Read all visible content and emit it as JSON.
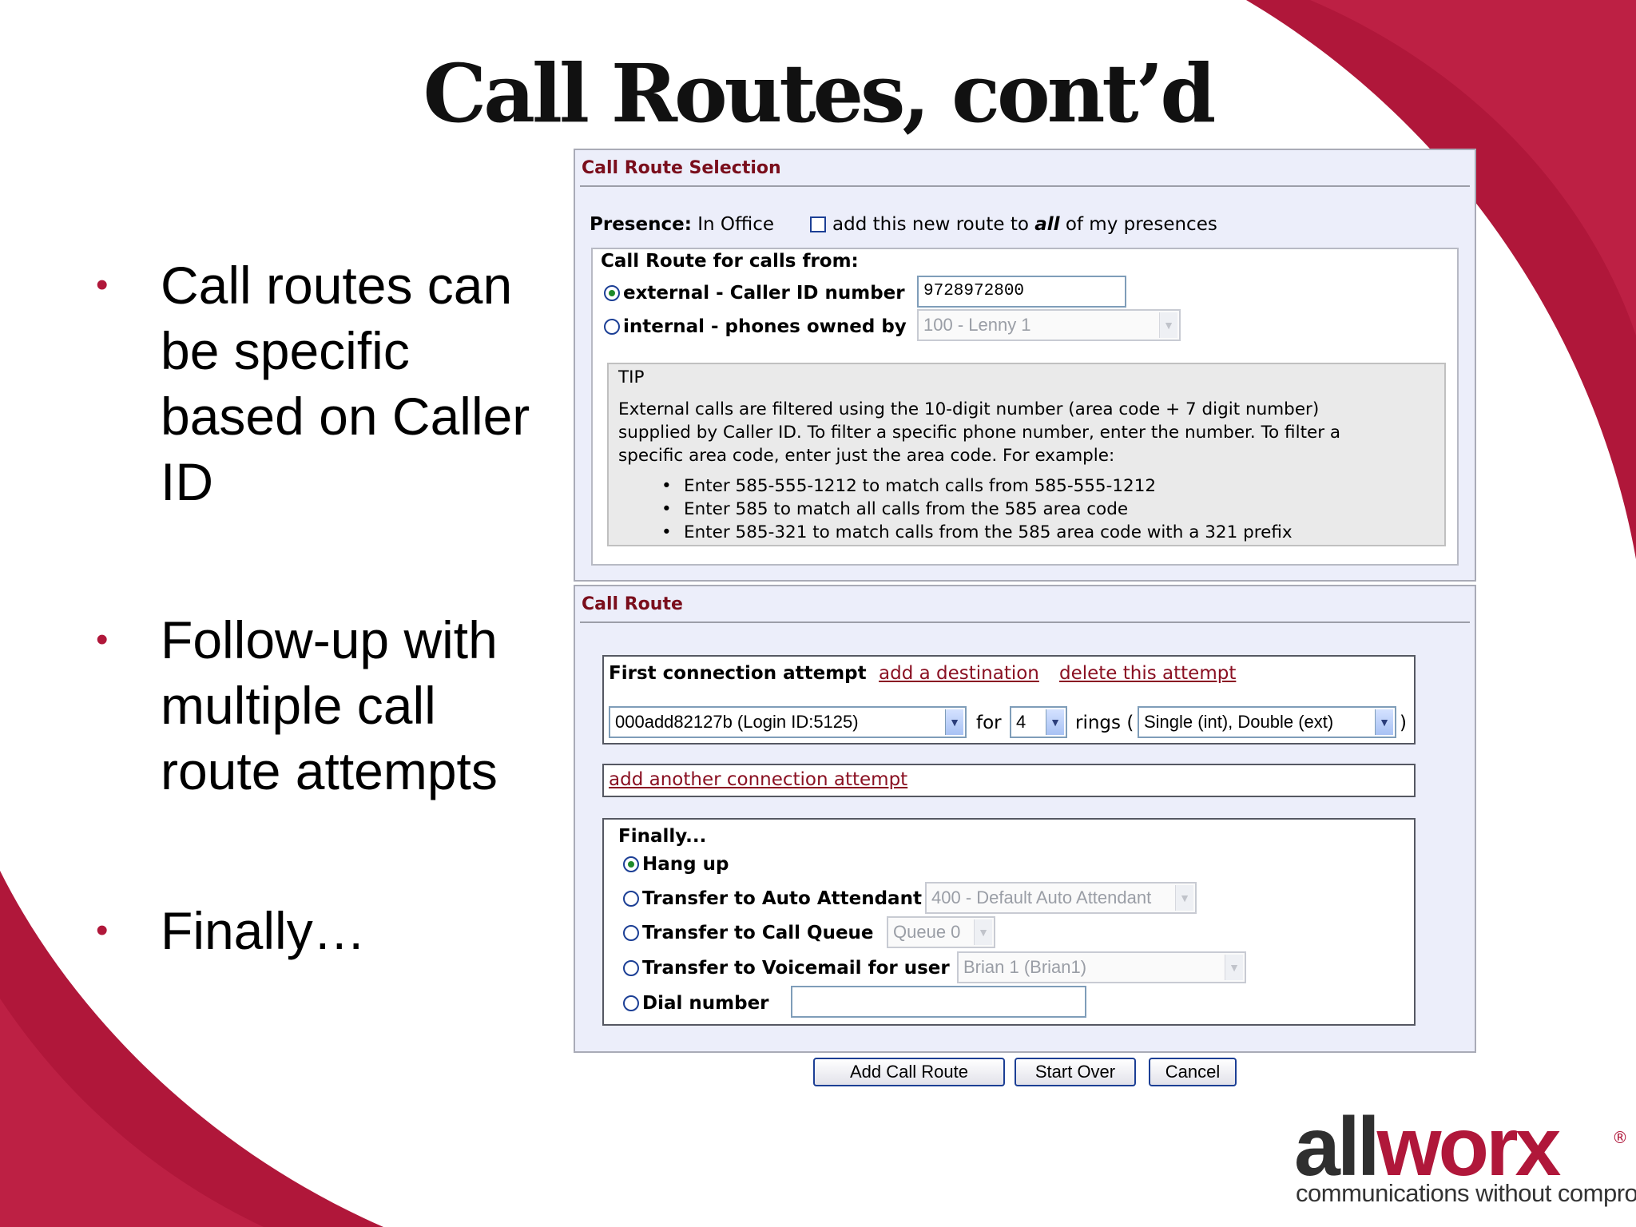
{
  "slide": {
    "title": "Call Routes, cont’d",
    "bullets": [
      "Call routes can be specific based on Caller ID",
      "Follow-up with multiple call route attempts",
      "Finally…"
    ]
  },
  "selection_panel": {
    "heading": "Call Route Selection",
    "presence_label": "Presence:",
    "presence_value": "In Office",
    "add_all_pre": "add this new route to",
    "add_all_em": "all",
    "add_all_post": "of my presences",
    "calls_from_heading": "Call Route for calls from:",
    "external_label": "external - Caller ID number",
    "external_value": "9728972800",
    "internal_label": "internal - phones owned by",
    "internal_value": "100 - Lenny 1",
    "tip": {
      "title": "TIP",
      "lines": [
        "External calls are filtered using the 10-digit number (area code + 7 digit number)",
        "supplied by Caller ID. To filter a specific phone number, enter the number. To filter a",
        "specific area code, enter just the area code. For example:"
      ],
      "items": [
        "Enter 585-555-1212 to match calls from 585-555-1212",
        "Enter 585 to match all calls from the 585 area code",
        "Enter 585-321 to match calls from the 585 area code with a 321 prefix"
      ]
    }
  },
  "route_panel": {
    "heading": "Call Route",
    "first_attempt_label": "First connection attempt",
    "add_destination": "add a destination",
    "delete_attempt": "delete this attempt",
    "destination_value": "000add82127b (Login ID:5125)",
    "for_label": "for",
    "rings_value": "4",
    "rings_label": "rings (",
    "ring_type_value": "Single (int), Double (ext)",
    "close_paren": ")",
    "add_another": "add another connection attempt",
    "finally_heading": "Finally...",
    "options": [
      "Hang up",
      "Transfer to Auto Attendant",
      "Transfer to Call Queue",
      "Transfer to Voicemail for user",
      "Dial number"
    ],
    "auto_attendant_value": "400 - Default Auto Attendant",
    "queue_value": "Queue 0",
    "voicemail_value": "Brian 1 (Brian1)",
    "dial_value": ""
  },
  "buttons": {
    "add": "Add Call Route",
    "start_over": "Start Over",
    "cancel": "Cancel"
  },
  "logo": {
    "all": "all",
    "worx": "worx",
    "reg": "®",
    "tagline": "communications without compromise"
  },
  "colors": {
    "brand_red": "#b0173a",
    "panel_heading": "#7a0e1c",
    "panel_bg": "#eceefa"
  }
}
